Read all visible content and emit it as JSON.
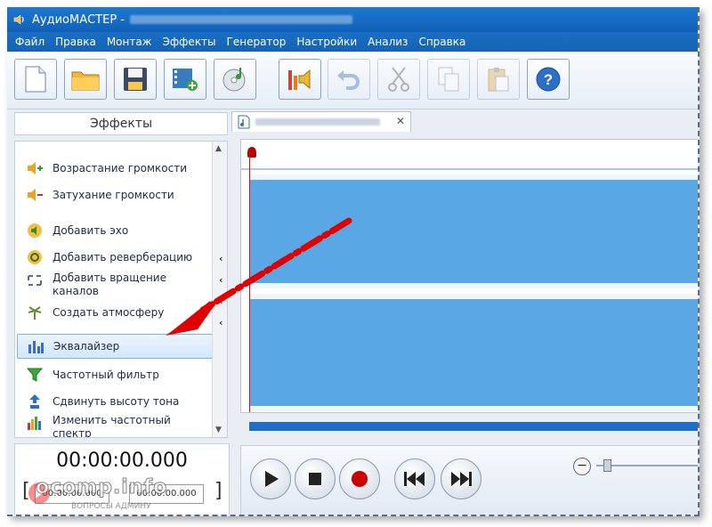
{
  "window": {
    "title": "АудиоМАСТЕР -"
  },
  "menu": [
    "Файл",
    "Правка",
    "Монтаж",
    "Эффекты",
    "Генератор",
    "Настройки",
    "Анализ",
    "Справка"
  ],
  "toolbar": {
    "icons": [
      "new-file-icon",
      "open-folder-icon",
      "save-icon",
      "add-video-icon",
      "add-cd-icon",
      "audio-properties-icon",
      "undo-icon",
      "cut-icon",
      "copy-icon",
      "paste-icon",
      "help-icon"
    ]
  },
  "effects_panel": {
    "header": "Эффекты",
    "items": [
      {
        "label": "Возрастание громкости"
      },
      {
        "label": "Затухание громкости"
      },
      {
        "label": "Добавить эхо"
      },
      {
        "label": "Добавить реверберацию"
      },
      {
        "label": "Добавить вращение каналов"
      },
      {
        "label": "Создать атмосферу"
      },
      {
        "label": "Эквалайзер"
      },
      {
        "label": "Частотный фильтр"
      },
      {
        "label": "Сдвинуть высоту тона"
      },
      {
        "label": "Изменить частотный спектр"
      }
    ],
    "selected_index": 6
  },
  "time": {
    "current": "00:00:00.000",
    "start": "00:00:00.000",
    "end": "00:00:00.000"
  },
  "tab": {
    "close_glyph": "✕"
  },
  "transport": {
    "icons": [
      "play-icon",
      "stop-icon",
      "record-icon",
      "rewind-icon",
      "fast-forward-icon"
    ]
  },
  "zoom": {
    "minus_glyph": "−"
  },
  "watermark": {
    "text": "ocomp.info",
    "sub": "ВОПРОСЫ АДМИНУ"
  },
  "colors": {
    "accent": "#1565c0",
    "wave": "#59a7e5",
    "playhead": "#d01010",
    "arrow": "#e00000"
  }
}
